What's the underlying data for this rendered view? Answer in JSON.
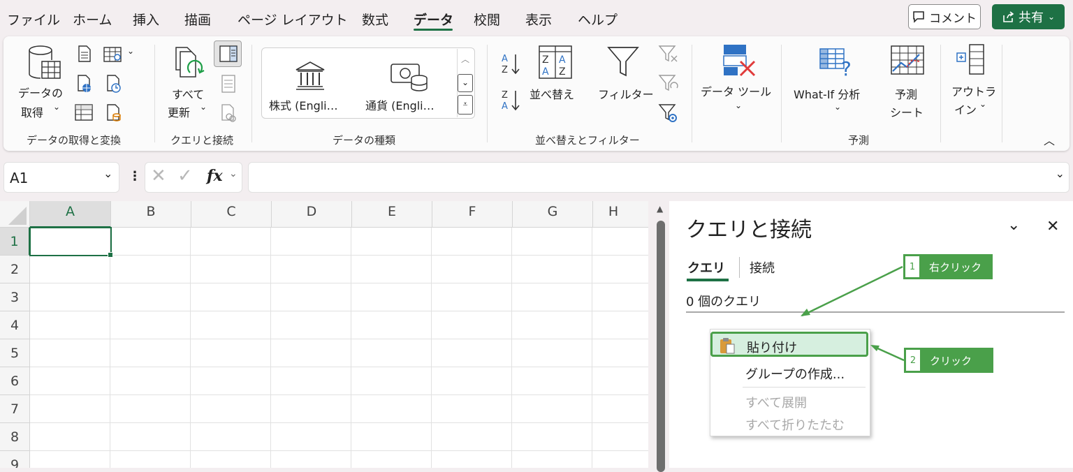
{
  "menu": {
    "tabs": [
      "ファイル",
      "ホーム",
      "挿入",
      "描画",
      "ページ レイアウト",
      "数式",
      "データ",
      "校閲",
      "表示",
      "ヘルプ"
    ],
    "active_tab": "データ",
    "comment_label": "コメント",
    "share_label": "共有"
  },
  "ribbon": {
    "get_data": {
      "label_line1": "データの",
      "label_line2": "取得"
    },
    "refresh_all": {
      "label_line1": "すべて",
      "label_line2": "更新"
    },
    "stocks_label": "株式 (Engli…",
    "currency_label": "通貨 (Engli…",
    "sort_label": "並べ替え",
    "filter_label": "フィルター",
    "data_tools_label": "データ ツール",
    "whatif_label": "What-If 分析",
    "forecast_sheet": {
      "line1": "予測",
      "line2": "シート"
    },
    "outline": {
      "line1": "アウトラ",
      "line2": "イン"
    },
    "groups": {
      "get_transform": "データの取得と変換",
      "queries_connections": "クエリと接続",
      "data_types": "データの種類",
      "sort_filter": "並べ替えとフィルター",
      "forecast": "予測"
    }
  },
  "formula_bar": {
    "name_box": "A1",
    "fx": "fx",
    "value": ""
  },
  "grid": {
    "columns": [
      "A",
      "B",
      "C",
      "D",
      "E",
      "F",
      "G",
      "H"
    ],
    "rows": [
      "1",
      "2",
      "3",
      "4",
      "5",
      "6",
      "7",
      "8",
      "9"
    ],
    "selected_cell": "A1"
  },
  "pane": {
    "title": "クエリと接続",
    "tabs": [
      "クエリ",
      "接続"
    ],
    "active_tab": "クエリ",
    "query_count": "0 個のクエリ",
    "context_menu": [
      "貼り付け",
      "グループの作成...",
      "すべて展開",
      "すべて折りたたむ"
    ],
    "highlighted_item": "貼り付け"
  },
  "callouts": [
    {
      "number": "1",
      "text": "右クリック"
    },
    {
      "number": "2",
      "text": "クリック"
    }
  ],
  "colors": {
    "excel_green": "#1e7145",
    "callout_green": "#4aa04a",
    "highlight_fill": "#d6efdf",
    "accent_blue": "#2f72c4",
    "accent_red": "#e03a3a"
  }
}
